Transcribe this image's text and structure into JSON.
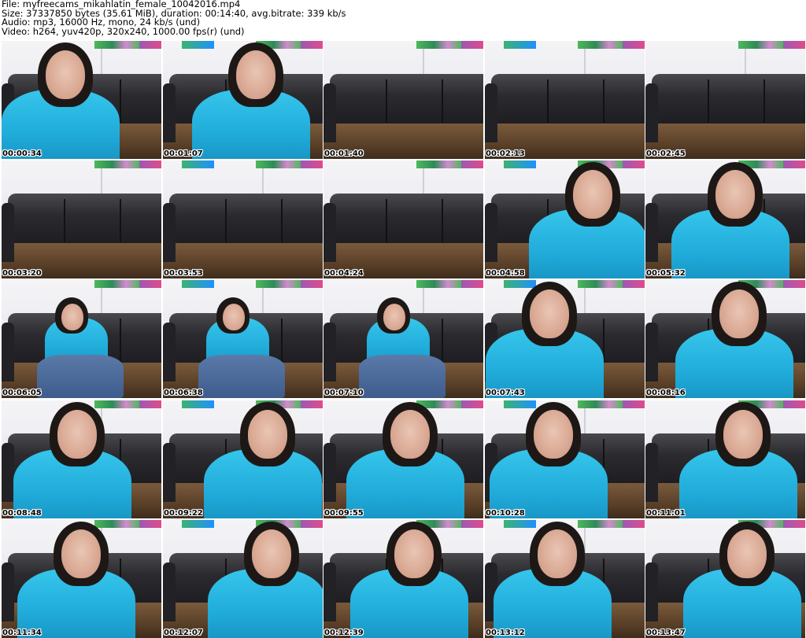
{
  "header": {
    "file": "File: myfreecams_mikahlatin_female_10042016.mp4",
    "size": "Size: 37337850 bytes (35.61 MiB), duration: 00:14:40, avg.bitrate: 339 kb/s",
    "audio": "Audio: mp3, 16000 Hz, mono, 24 kb/s (und)",
    "video": "Video: h264, yuv420p, 320x240, 1000.00 fps(r) (und)"
  },
  "thumbnails": [
    {
      "time": "00:00:34",
      "scene": "person"
    },
    {
      "time": "00:01:07",
      "scene": "person"
    },
    {
      "time": "00:01:40",
      "scene": "empty"
    },
    {
      "time": "00:02:13",
      "scene": "empty"
    },
    {
      "time": "00:02:45",
      "scene": "empty"
    },
    {
      "time": "00:03:20",
      "scene": "empty"
    },
    {
      "time": "00:03:53",
      "scene": "empty"
    },
    {
      "time": "00:04:24",
      "scene": "empty"
    },
    {
      "time": "00:04:58",
      "scene": "person"
    },
    {
      "time": "00:05:32",
      "scene": "person"
    },
    {
      "time": "00:06:05",
      "scene": "seated"
    },
    {
      "time": "00:06:38",
      "scene": "seated"
    },
    {
      "time": "00:07:10",
      "scene": "seated"
    },
    {
      "time": "00:07:43",
      "scene": "person"
    },
    {
      "time": "00:08:16",
      "scene": "person"
    },
    {
      "time": "00:08:48",
      "scene": "person"
    },
    {
      "time": "00:09:22",
      "scene": "person"
    },
    {
      "time": "00:09:55",
      "scene": "person"
    },
    {
      "time": "00:10:28",
      "scene": "person"
    },
    {
      "time": "00:11:01",
      "scene": "person"
    },
    {
      "time": "00:11:34",
      "scene": "person"
    },
    {
      "time": "00:12:07",
      "scene": "person"
    },
    {
      "time": "00:12:39",
      "scene": "person"
    },
    {
      "time": "00:13:12",
      "scene": "person"
    },
    {
      "time": "00:13:47",
      "scene": "person"
    }
  ]
}
